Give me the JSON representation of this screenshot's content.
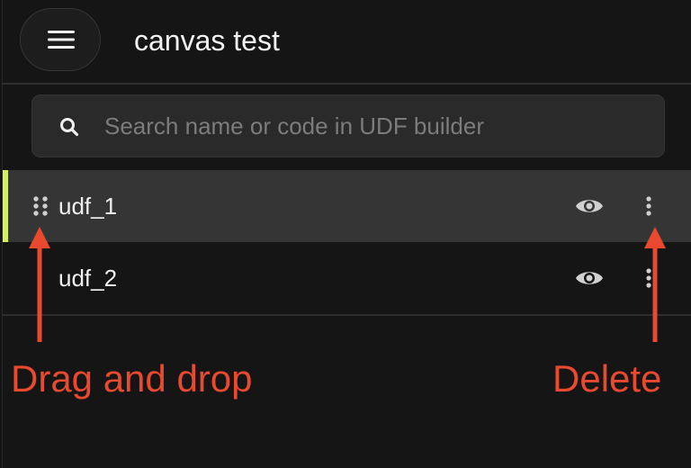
{
  "header": {
    "title": "canvas test",
    "menu_icon": "hamburger-menu-icon"
  },
  "search": {
    "icon": "search-icon",
    "placeholder": "Search name or code in UDF builder",
    "value": ""
  },
  "udf_list": [
    {
      "name": "udf_1",
      "selected": true,
      "visibility_icon": "eye-icon",
      "more_icon": "more-vertical-icon",
      "drag_icon": "drag-handle-icon"
    },
    {
      "name": "udf_2",
      "selected": false,
      "visibility_icon": "eye-icon",
      "more_icon": "more-vertical-icon"
    }
  ],
  "annotations": {
    "drag_label": "Drag and drop",
    "delete_label": "Delete"
  },
  "colors": {
    "background": "#151515",
    "selected_row": "#353535",
    "selection_accent": "#d4f05a",
    "annotation": "#e8492f",
    "icon": "#d0d0d0"
  }
}
